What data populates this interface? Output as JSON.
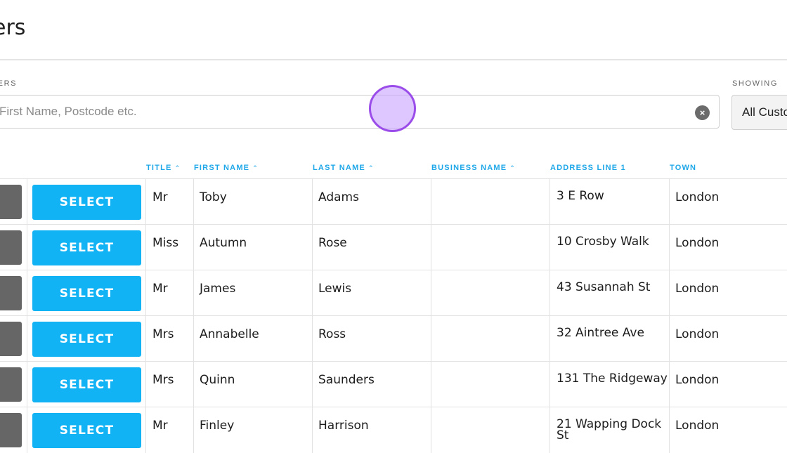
{
  "page": {
    "title": "ers"
  },
  "search": {
    "label": "IERS",
    "placeholder": "First Name, Postcode etc.",
    "value": "",
    "clear_icon": "×"
  },
  "showing": {
    "label": "SHOWING",
    "value": "All Custo"
  },
  "table": {
    "columns": [
      {
        "label": "TITLE",
        "sortable": true
      },
      {
        "label": "FIRST NAME",
        "sortable": true
      },
      {
        "label": "LAST NAME",
        "sortable": true
      },
      {
        "label": "BUSINESS NAME",
        "sortable": true
      },
      {
        "label": "ADDRESS LINE 1",
        "sortable": false
      },
      {
        "label": "TOWN",
        "sortable": false
      }
    ],
    "sort_icon": "⌃",
    "select_label": "SELECT",
    "rows": [
      {
        "title": "Mr",
        "first": "Toby",
        "last": "Adams",
        "business": "",
        "address": "3 E Row",
        "town": "London"
      },
      {
        "title": "Miss",
        "first": "Autumn",
        "last": "Rose",
        "business": "",
        "address": "10 Crosby Walk",
        "town": "London"
      },
      {
        "title": "Mr",
        "first": "James",
        "last": "Lewis",
        "business": "",
        "address": "43 Susannah St",
        "town": "London"
      },
      {
        "title": "Mrs",
        "first": "Annabelle",
        "last": "Ross",
        "business": "",
        "address": "32 Aintree Ave",
        "town": "London"
      },
      {
        "title": "Mrs",
        "first": "Quinn",
        "last": "Saunders",
        "business": "",
        "address": "131 The Ridgeway",
        "town": "London"
      },
      {
        "title": "Mr",
        "first": "Finley",
        "last": "Harrison",
        "business": "",
        "address": "21 Wapping Dock St",
        "town": "London"
      }
    ]
  },
  "colors": {
    "accent": "#12b3f5",
    "header_text": "#1ea7e8",
    "cursor": "#9b4dea"
  }
}
